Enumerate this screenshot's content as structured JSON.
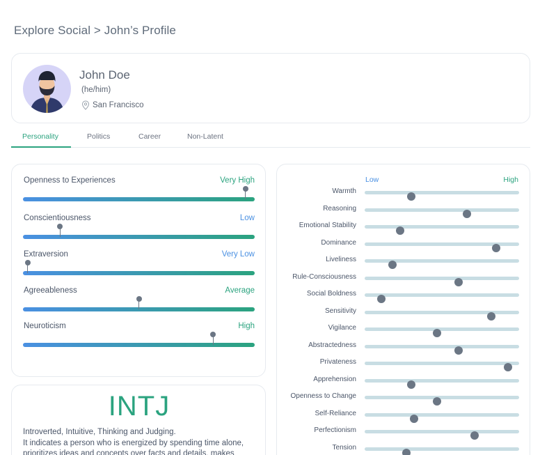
{
  "breadcrumb": "Explore Social > John’s Profile",
  "profile": {
    "name": "John Doe",
    "pronouns": "(he/him)",
    "location": "San Francisco"
  },
  "tabs": [
    {
      "label": "Personality",
      "active": true
    },
    {
      "label": "Politics",
      "active": false
    },
    {
      "label": "Career",
      "active": false
    },
    {
      "label": "Non-Latent",
      "active": false
    }
  ],
  "big_five": [
    {
      "label": "Openness to Experiences",
      "level": "Very High",
      "score": 0.96
    },
    {
      "label": "Conscientiousness",
      "level": "Low",
      "score": 0.16
    },
    {
      "label": "Extraversion",
      "level": "Very Low",
      "score": 0.02
    },
    {
      "label": "Agreeableness",
      "level": "Average",
      "score": 0.5
    },
    {
      "label": "Neuroticism",
      "level": "High",
      "score": 0.82
    }
  ],
  "mbti": {
    "type": "INTJ",
    "summary": "Introverted, Intuitive, Thinking and Judging.",
    "description": "It indicates a person who is energized by spending time alone, prioritizes ideas and concepts over facts and details, makes"
  },
  "factors": {
    "low_label": "Low",
    "high_label": "High",
    "items": [
      {
        "label": "Warmth",
        "score": 0.3
      },
      {
        "label": "Reasoning",
        "score": 0.66
      },
      {
        "label": "Emotional Stability",
        "score": 0.23
      },
      {
        "label": "Dominance",
        "score": 0.85
      },
      {
        "label": "Liveliness",
        "score": 0.18
      },
      {
        "label": "Rule-Consciousness",
        "score": 0.61
      },
      {
        "label": "Social Boldness",
        "score": 0.11
      },
      {
        "label": "Sensitivity",
        "score": 0.82
      },
      {
        "label": "Vigilance",
        "score": 0.47
      },
      {
        "label": "Abstractedness",
        "score": 0.61
      },
      {
        "label": "Privateness",
        "score": 0.93
      },
      {
        "label": "Apprehension",
        "score": 0.3
      },
      {
        "label": "Openness to Change",
        "score": 0.47
      },
      {
        "label": "Self-Reliance",
        "score": 0.32
      },
      {
        "label": "Perfectionism",
        "score": 0.71
      },
      {
        "label": "Tension",
        "score": 0.27
      }
    ]
  },
  "colors": {
    "accent": "#2ba37f",
    "low": "#4a90e2",
    "marker": "#6b7684"
  }
}
